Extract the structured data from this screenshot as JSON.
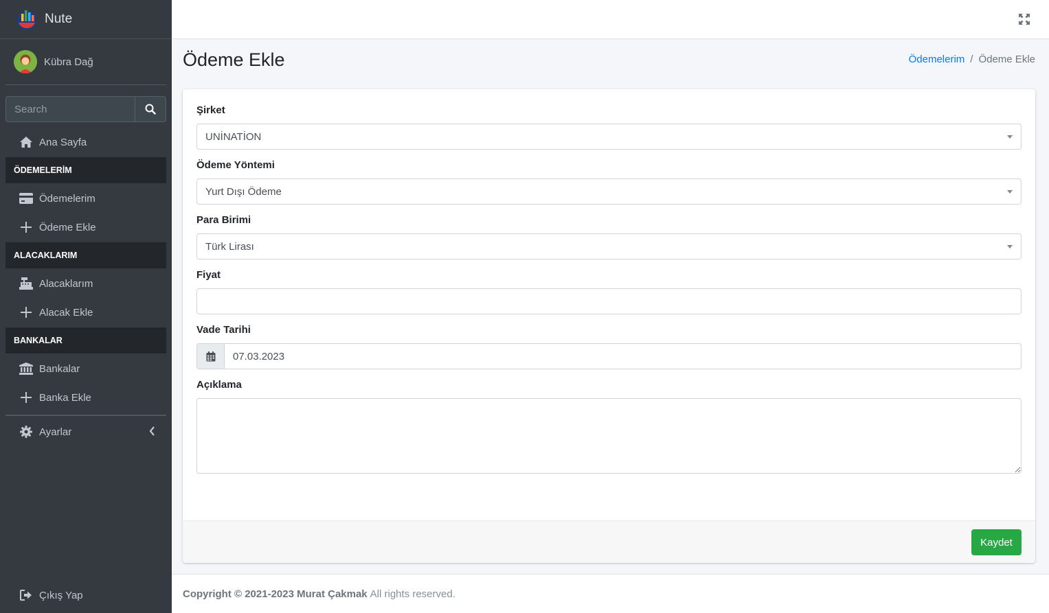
{
  "brand": {
    "name": "Nute",
    "icon": "chart-logo-icon"
  },
  "user": {
    "name": "Kübra Dağ",
    "avatar_icon": "woman-avatar-icon"
  },
  "search": {
    "placeholder": "Search"
  },
  "sidebar": {
    "home": {
      "label": "Ana Sayfa",
      "icon": "home-icon"
    },
    "sections": [
      {
        "header": "ÖDEMELERİM",
        "items": [
          {
            "label": "Ödemelerim",
            "icon": "credit-card-icon"
          },
          {
            "label": "Ödeme Ekle",
            "icon": "plus-icon"
          }
        ]
      },
      {
        "header": "ALACAKLARIM",
        "items": [
          {
            "label": "Alacaklarım",
            "icon": "cash-register-icon"
          },
          {
            "label": "Alacak Ekle",
            "icon": "plus-icon"
          }
        ]
      },
      {
        "header": "BANKALAR",
        "items": [
          {
            "label": "Bankalar",
            "icon": "bank-icon"
          },
          {
            "label": "Banka Ekle",
            "icon": "plus-icon"
          }
        ]
      }
    ],
    "settings": {
      "label": "Ayarlar",
      "icon": "gear-icon"
    },
    "logout": {
      "label": "Çıkış Yap",
      "icon": "sign-out-icon"
    }
  },
  "page": {
    "title": "Ödeme Ekle",
    "breadcrumb": {
      "parent": "Ödemelerim",
      "separator": "/",
      "current": "Ödeme Ekle"
    }
  },
  "form": {
    "company": {
      "label": "Şirket",
      "value": "UNİNATİON"
    },
    "payment_method": {
      "label": "Ödeme Yöntemi",
      "value": "Yurt Dışı Ödeme"
    },
    "currency": {
      "label": "Para Birimi",
      "value": "Türk Lirası"
    },
    "price": {
      "label": "Fiyat",
      "value": ""
    },
    "due_date": {
      "label": "Vade Tarihi",
      "value": "07.03.2023"
    },
    "description": {
      "label": "Açıklama",
      "value": ""
    },
    "submit_label": "Kaydet"
  },
  "footer": {
    "copyright": "Copyright © 2021-2023 Murat Çakmak",
    "rest": "All rights reserved."
  },
  "colors": {
    "sidebar_bg": "#343a40",
    "accent": "#007bff",
    "success": "#28a745"
  }
}
